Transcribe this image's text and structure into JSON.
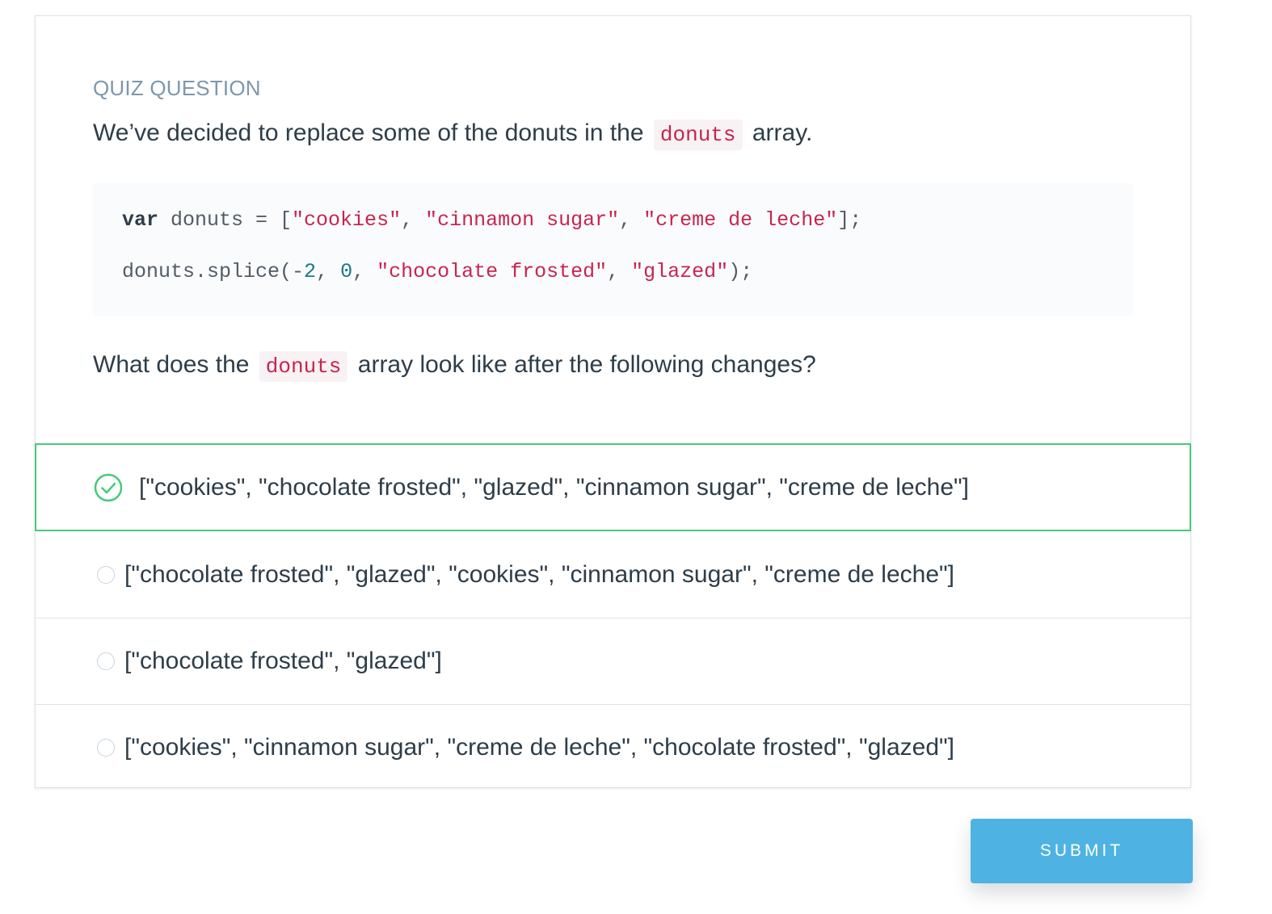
{
  "quiz": {
    "label": "QUIZ QUESTION",
    "prompt": {
      "before": "We’ve decided to replace some of the donuts in the",
      "code": "donuts",
      "after": "array."
    },
    "code_block": {
      "line1": {
        "keyword": "var",
        "text1": " donuts = [",
        "s1": "\"cookies\"",
        "sep1": ", ",
        "s2": "\"cinnamon sugar\"",
        "sep2": ", ",
        "s3": "\"creme de leche\"",
        "end": "];"
      },
      "line2": {
        "text1": "donuts.splice(-",
        "n1": "2",
        "sep1": ", ",
        "n2": "0",
        "sep2": ", ",
        "s1": "\"chocolate frosted\"",
        "sep3": ", ",
        "s2": "\"glazed\"",
        "end": ");"
      }
    },
    "question": {
      "before": "What does the",
      "code": "donuts",
      "after": "array look like after the following changes?"
    },
    "options": [
      {
        "label": "[\"cookies\", \"chocolate frosted\", \"glazed\", \"cinnamon sugar\", \"creme de leche\"]",
        "selected": true
      },
      {
        "label": "[\"chocolate frosted\", \"glazed\", \"cookies\", \"cinnamon sugar\", \"creme de leche\"]",
        "selected": false
      },
      {
        "label": "[\"chocolate frosted\", \"glazed\"]",
        "selected": false
      },
      {
        "label": "[\"cookies\", \"cinnamon sugar\", \"creme de leche\", \"chocolate frosted\", \"glazed\"]",
        "selected": false
      }
    ],
    "submit_label": "SUBMIT"
  },
  "icons": {
    "selected": "check-circle-icon",
    "unselected": "radio-circle-icon"
  },
  "colors": {
    "accent_green": "#47c97a",
    "submit_blue": "#4eb3e2",
    "code_red": "#c7254e",
    "label_gray": "#7d97ad"
  }
}
